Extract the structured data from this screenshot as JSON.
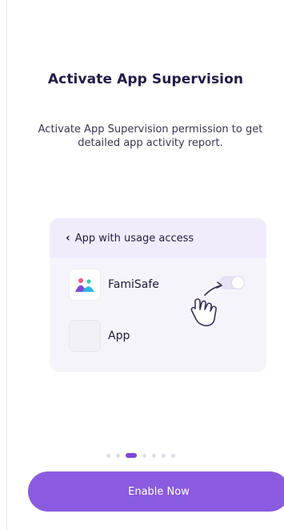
{
  "title": "Activate App Supervision",
  "subtitle": "Activate App Supervision permission to get detailed app activity report.",
  "card": {
    "back_icon": "chevron-left-icon",
    "header_label": "App with usage access",
    "apps": [
      {
        "name": "FamiSafe",
        "icon": "famisafe-logo-icon",
        "toggle_on": false
      },
      {
        "name": "App",
        "icon": "blank-app-icon"
      }
    ]
  },
  "pagination": {
    "total": 7,
    "active_index": 2
  },
  "primary_button": {
    "label": "Enable Now"
  },
  "colors": {
    "accent": "#8a5be0",
    "active_dot": "#7c4ad6",
    "card_bg": "#f6f4fb",
    "header_bg": "#f1ecfb"
  }
}
